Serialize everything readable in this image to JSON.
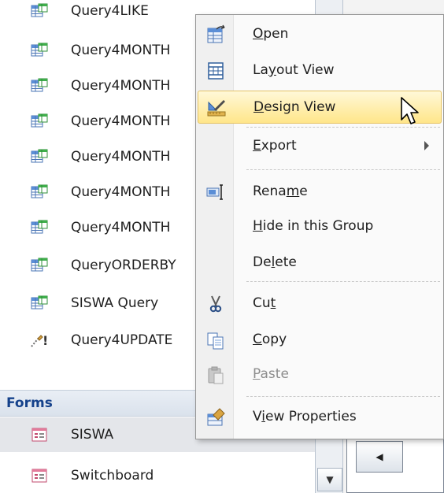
{
  "nav": {
    "queries": [
      {
        "label": "Query4LIKE",
        "icon": "select-query-icon"
      },
      {
        "label": "Query4MONTH",
        "icon": "select-query-icon"
      },
      {
        "label": "Query4MONTH",
        "icon": "select-query-icon"
      },
      {
        "label": "Query4MONTH",
        "icon": "select-query-icon"
      },
      {
        "label": "Query4MONTH",
        "icon": "select-query-icon"
      },
      {
        "label": "Query4MONTH",
        "icon": "select-query-icon"
      },
      {
        "label": "Query4MONTH",
        "icon": "select-query-icon"
      },
      {
        "label": "QueryORDERBY",
        "icon": "select-query-icon"
      },
      {
        "label": "SISWA Query",
        "icon": "select-query-icon"
      },
      {
        "label": "Query4UPDATE",
        "icon": "update-query-icon"
      }
    ],
    "forms_header": "Forms",
    "forms": [
      {
        "label": "SISWA",
        "icon": "form-icon"
      },
      {
        "label": "Switchboard",
        "icon": "form-icon"
      }
    ]
  },
  "context_menu": {
    "items": [
      {
        "pre": "",
        "ul": "O",
        "post": "pen",
        "icon": "open-icon"
      },
      {
        "pre": "La",
        "ul": "y",
        "post": "out View",
        "icon": "layout-view-icon"
      },
      {
        "pre": "",
        "ul": "D",
        "post": "esign View",
        "icon": "design-view-icon"
      },
      {
        "pre": "",
        "ul": "E",
        "post": "xport",
        "icon": "none"
      },
      {
        "pre": "Rena",
        "ul": "m",
        "post": "e",
        "icon": "rename-icon"
      },
      {
        "pre": "",
        "ul": "H",
        "post": "ide in this Group",
        "icon": "none"
      },
      {
        "pre": "De",
        "ul": "l",
        "post": "ete",
        "icon": "none"
      },
      {
        "pre": "Cu",
        "ul": "t",
        "post": "",
        "icon": "cut-icon"
      },
      {
        "pre": "",
        "ul": "C",
        "post": "opy",
        "icon": "copy-icon"
      },
      {
        "pre": "",
        "ul": "P",
        "post": "aste",
        "icon": "paste-icon"
      },
      {
        "pre": "V",
        "ul": "i",
        "post": "ew Properties",
        "icon": "properties-icon"
      }
    ],
    "highlighted": "Design View",
    "disabled": "Paste"
  },
  "colors": {
    "menu_highlight": "#ffe68a",
    "forms_header_text": "#15428b",
    "selected_row": "#e4e6ea"
  }
}
